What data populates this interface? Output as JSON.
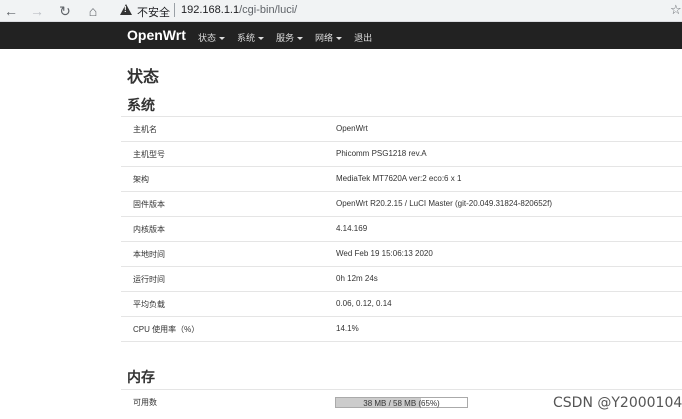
{
  "browser": {
    "insecure_label": "不安全",
    "url_host": "192.168.1.1",
    "url_path": "/cgi-bin/luci/"
  },
  "nav": {
    "brand": "OpenWrt",
    "menu": [
      {
        "label": "状态"
      },
      {
        "label": "系统"
      },
      {
        "label": "服务"
      },
      {
        "label": "网络"
      },
      {
        "label": "退出"
      }
    ]
  },
  "page": {
    "title": "状态",
    "system": {
      "heading": "系统",
      "rows": [
        {
          "label": "主机名",
          "value": "OpenWrt"
        },
        {
          "label": "主机型号",
          "value": "Phicomm PSG1218 rev.A"
        },
        {
          "label": "架构",
          "value": "MediaTek MT7620A ver:2 eco:6 x 1"
        },
        {
          "label": "固件版本",
          "value": "OpenWrt R20.2.15 / LuCI Master (git-20.049.31824-820652f)"
        },
        {
          "label": "内核版本",
          "value": "4.14.169"
        },
        {
          "label": "本地时间",
          "value": "Wed Feb 19 15:06:13 2020"
        },
        {
          "label": "运行时间",
          "value": "0h 12m 24s"
        },
        {
          "label": "平均负载",
          "value": "0.06, 0.12, 0.14"
        },
        {
          "label": "CPU 使用率（%）",
          "value": "14.1%"
        }
      ]
    },
    "memory": {
      "heading": "内存",
      "rows": [
        {
          "label": "可用数",
          "value": "38 MB / 58 MB (65%)",
          "fraction": 0.65
        }
      ]
    }
  },
  "watermark": "CSDN @Y2000104",
  "icons": {
    "back": "arrow-left-icon",
    "forward": "arrow-right-icon",
    "reload": "reload-icon",
    "home": "home-icon",
    "warning": "warning-triangle-icon",
    "bookmark": "star-icon"
  }
}
